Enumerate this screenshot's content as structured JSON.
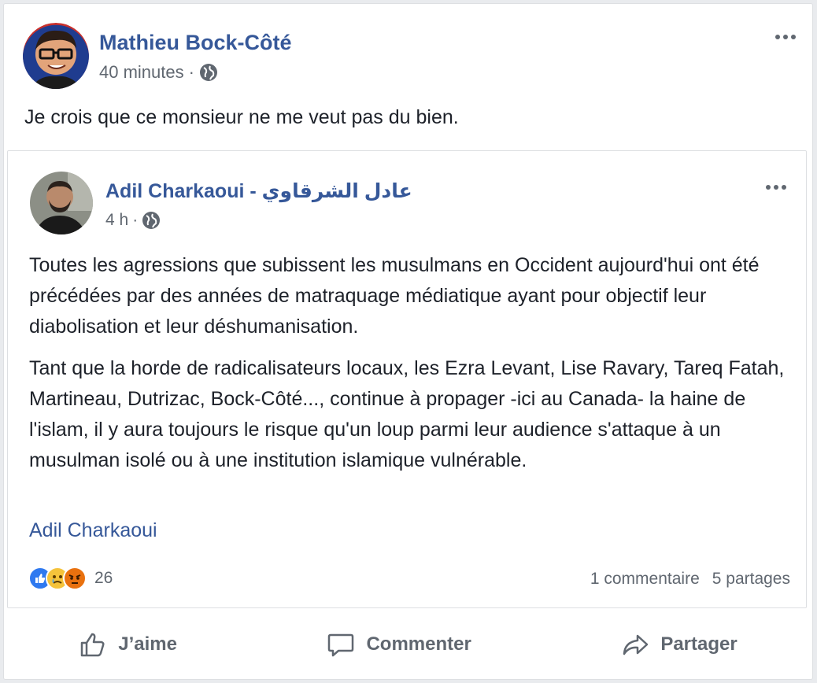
{
  "post": {
    "author": "Mathieu Bock-Côté",
    "time": "40 minutes",
    "separator": "·",
    "text": "Je crois que ce monsieur ne me veut pas du bien.",
    "privacy_icon": "globe-icon",
    "more_icon": "more-options-icon"
  },
  "shared_post": {
    "author": "Adil Charkaoui - عادل الشرقاوي",
    "time": "4 h",
    "separator": "·",
    "privacy_icon": "globe-icon",
    "paragraphs": [
      "Toutes les agressions que subissent les musulmans en Occident aujourd'hui ont été précédées par des années de matraquage médiatique ayant pour objectif leur diabolisation et leur déshumanisation.",
      "Tant que la horde de radicalisateurs locaux, les Ezra Levant, Lise Ravary, Tareq Fatah, Martineau, Dutrizac, Bock-Côté..., continue à propager -ici au Canada- la haine de l'islam, il y aura toujours le risque qu'un loup parmi leur audience s'attaque à un musulman isolé ou à une institution islamique vulnérable."
    ],
    "source": "Adil Charkaoui",
    "reaction_count": "26",
    "reactions": [
      "like-icon",
      "sad-icon",
      "angry-icon"
    ],
    "comments": "1 commentaire",
    "shares": "5 partages"
  },
  "actions": {
    "like": "J’aime",
    "comment": "Commenter",
    "share": "Partager"
  },
  "colors": {
    "link": "#365899",
    "meta": "#606770",
    "like": "#2f79f0",
    "sad": "#f5c33b",
    "angry": "#e9710f"
  }
}
